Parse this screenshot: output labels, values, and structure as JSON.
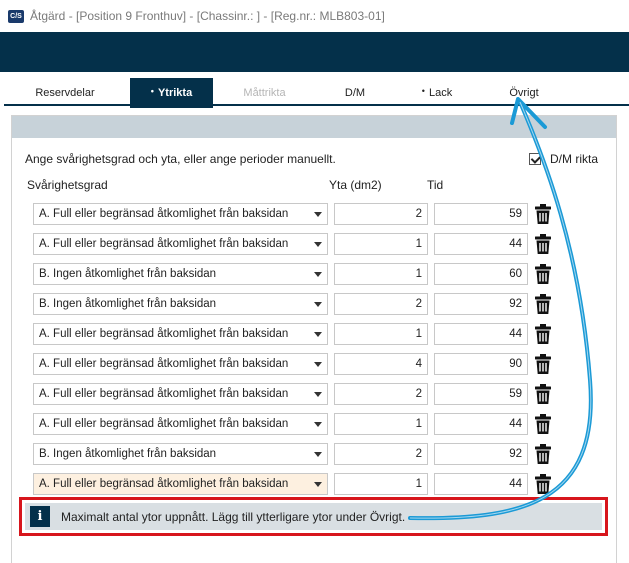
{
  "window": {
    "app_icon_text": "C/S",
    "title": "Åtgärd - [Position 9 Fronthuv] - [Chassinr.: ] - [Reg.nr.: MLB803-01]"
  },
  "tabs": [
    {
      "label": "Reservdelar",
      "marker": "",
      "state": "normal"
    },
    {
      "label": "Ytrikta",
      "marker": "•",
      "state": "active"
    },
    {
      "label": "Måttrikta",
      "marker": "",
      "state": "disabled"
    },
    {
      "label": "D/M",
      "marker": "",
      "state": "normal"
    },
    {
      "label": "Lack",
      "marker": "•",
      "state": "normal"
    },
    {
      "label": "Övrigt",
      "marker": "",
      "state": "normal"
    }
  ],
  "panel": {
    "instruction": "Ange svårighetsgrad och yta, eller ange perioder manuellt.",
    "dm_rikta_label": "D/M rikta",
    "dm_rikta_checked": true,
    "columns": {
      "difficulty": "Svårighetsgrad",
      "area": "Yta (dm2)",
      "time": "Tid"
    },
    "rows": [
      {
        "difficulty": "A. Full eller begränsad åtkomlighet från baksidan",
        "area": "2",
        "time": "59"
      },
      {
        "difficulty": "A. Full eller begränsad åtkomlighet från baksidan",
        "area": "1",
        "time": "44"
      },
      {
        "difficulty": "B. Ingen åtkomlighet från baksidan",
        "area": "1",
        "time": "60"
      },
      {
        "difficulty": "B. Ingen åtkomlighet från baksidan",
        "area": "2",
        "time": "92"
      },
      {
        "difficulty": "A. Full eller begränsad åtkomlighet från baksidan",
        "area": "1",
        "time": "44"
      },
      {
        "difficulty": "A. Full eller begränsad åtkomlighet från baksidan",
        "area": "4",
        "time": "90"
      },
      {
        "difficulty": "A. Full eller begränsad åtkomlighet från baksidan",
        "area": "2",
        "time": "59"
      },
      {
        "difficulty": "A. Full eller begränsad åtkomlighet från baksidan",
        "area": "1",
        "time": "44"
      },
      {
        "difficulty": "B. Ingen åtkomlighet från baksidan",
        "area": "2",
        "time": "92"
      },
      {
        "difficulty": "A. Full eller begränsad åtkomlighet från baksidan",
        "area": "1",
        "time": "44"
      }
    ],
    "row_icon": "trash-icon",
    "info_icon_text": "i",
    "info_message": "Maximalt antal ytor uppnått. Lägg till ytterligare ytor under Övrigt."
  },
  "colors": {
    "header_dark": "#04304a",
    "annotation_arrow": "#1b9ad6",
    "annotation_box": "#d7151c",
    "highlight_field": "#fdf0e0"
  }
}
